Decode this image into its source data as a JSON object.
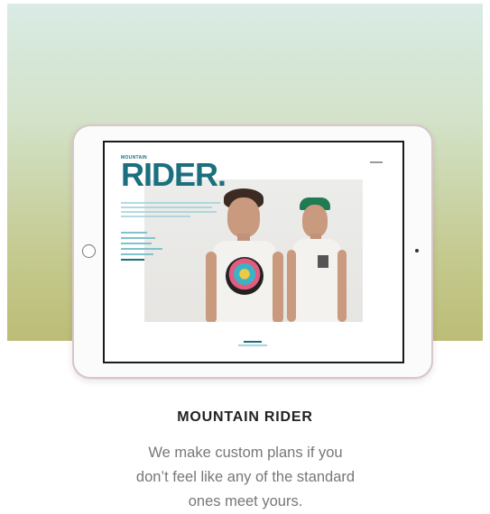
{
  "section": {
    "title": "MOUNTAIN RIDER",
    "description": "We make custom plans if you don’t feel like any of the standard ones meet yours."
  },
  "tablet_screen": {
    "brand_small": "MOUNTAIN",
    "brand_large": "RIDER."
  },
  "colors": {
    "brand": "#1c6f7e",
    "hero_top": "#d9ebe5",
    "hero_bottom": "#bcbd76"
  }
}
